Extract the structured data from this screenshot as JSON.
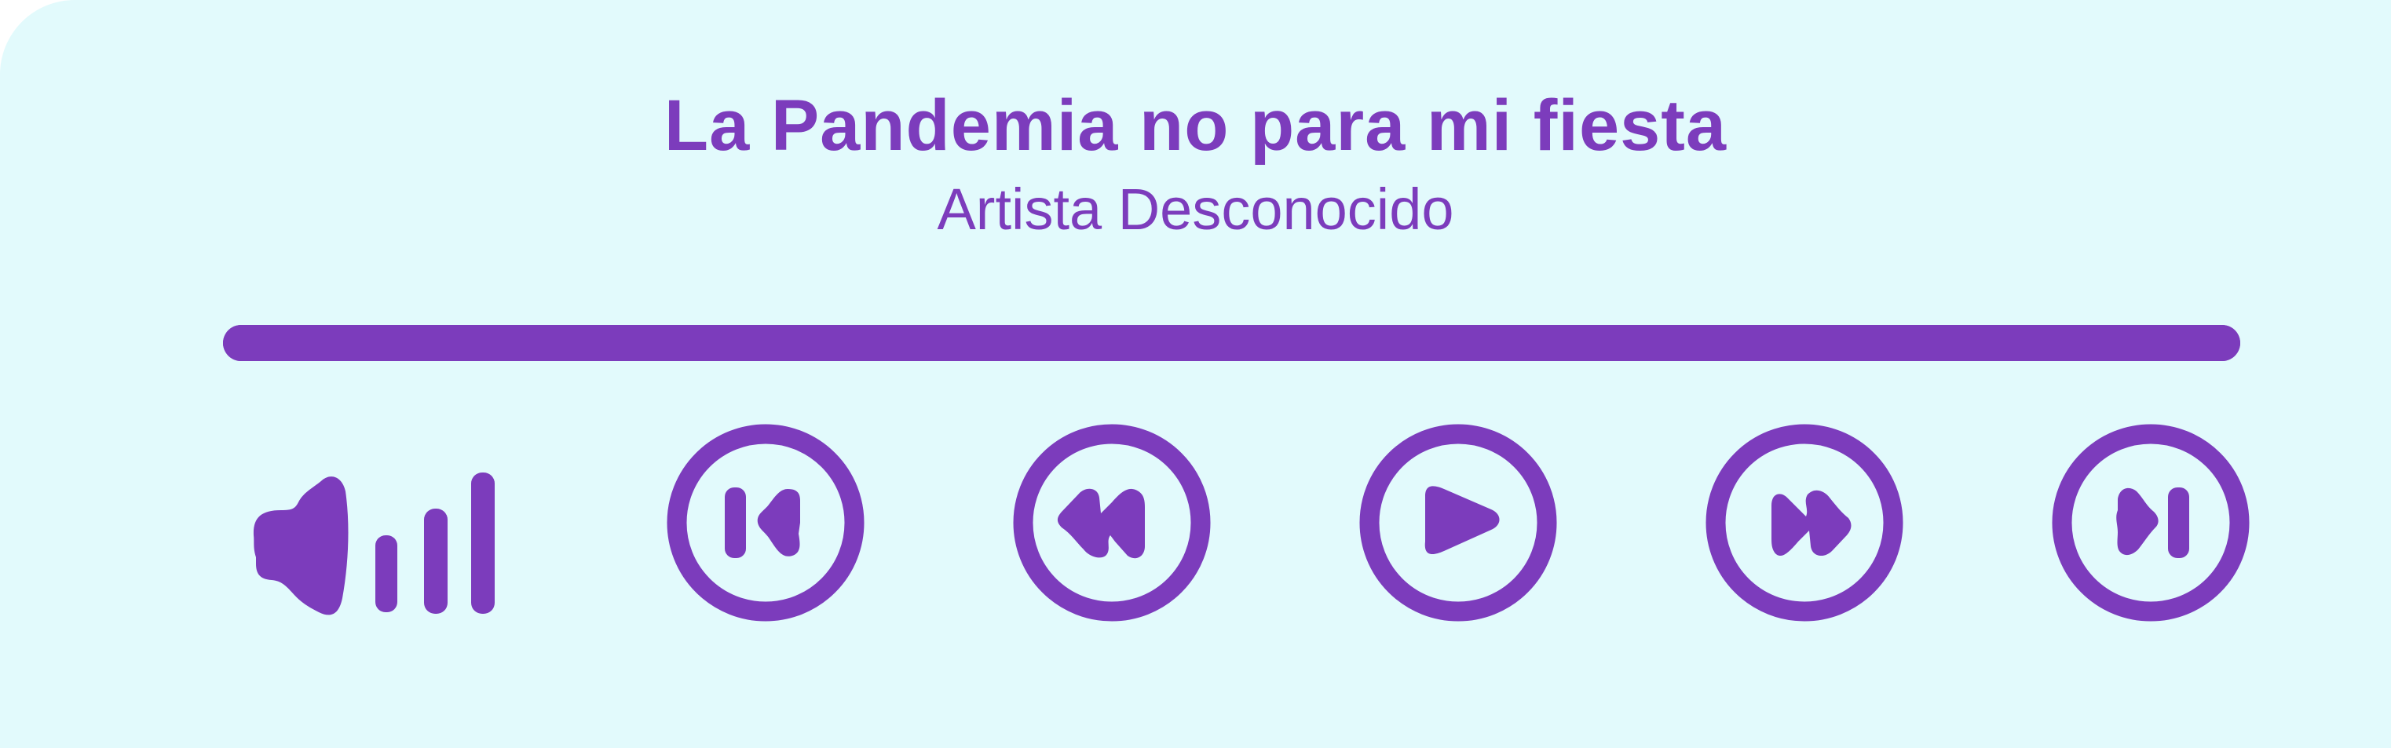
{
  "track": {
    "title": "La Pandemia no para mi fiesta",
    "artist": "Artista Desconocido"
  },
  "progress": {
    "value": 1.0
  },
  "volume": {
    "level": 1.0,
    "icon": "volume-high-icon"
  },
  "controls": [
    {
      "name": "skip-previous",
      "icon": "skip-previous-icon"
    },
    {
      "name": "rewind",
      "icon": "rewind-icon"
    },
    {
      "name": "play",
      "icon": "play-icon"
    },
    {
      "name": "fast-forward",
      "icon": "fast-forward-icon"
    },
    {
      "name": "skip-next",
      "icon": "skip-next-icon"
    }
  ],
  "colors": {
    "accent": "#7c3cbc",
    "background": "#e2fafc"
  }
}
